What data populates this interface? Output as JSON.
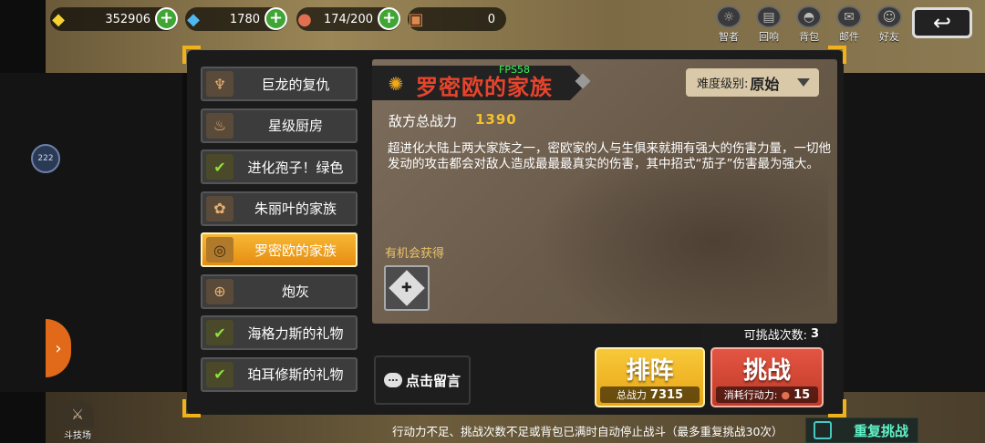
{
  "resources": {
    "gold": "352906",
    "gems": "1780",
    "stamina": "174/200",
    "tickets": "0"
  },
  "top_icons": [
    "智者",
    "回响",
    "背包",
    "邮件",
    "好友"
  ],
  "left_dial": "222",
  "stages": [
    {
      "label": "巨龙的复仇",
      "icon": "dragon-icon",
      "cleared": false
    },
    {
      "label": "星级厨房",
      "icon": "pot-icon",
      "cleared": false
    },
    {
      "label": "进化孢子！绿色",
      "icon": "check-icon",
      "cleared": true
    },
    {
      "label": "朱丽叶的家族",
      "icon": "flower-icon",
      "cleared": false
    },
    {
      "label": "罗密欧的家族",
      "icon": "spiral-icon",
      "cleared": false,
      "active": true
    },
    {
      "label": "炮灰",
      "icon": "target-icon",
      "cleared": false
    },
    {
      "label": "海格力斯的礼物",
      "icon": "check-icon",
      "cleared": true
    },
    {
      "label": "珀耳修斯的礼物",
      "icon": "check-icon",
      "cleared": true
    }
  ],
  "detail": {
    "title": "罗密欧的家族",
    "fps": "FPS58",
    "difficulty_label": "难度级别:",
    "difficulty_value": "原始",
    "enemy_power_label": "敌方总战力",
    "enemy_power_value": "1390",
    "description": "超进化大陆上两大家族之一，密欧家的人与生俱来就拥有强大的伤害力量，一切他发动的攻击都会对敌人造成最最最真实的伤害，其中招式“茄子”伤害最为强大。",
    "drop_label": "有机会获得",
    "challenges_label": "可挑战次数:",
    "challenges_value": "3"
  },
  "actions": {
    "comment": "点击留言",
    "lineup": "排阵",
    "lineup_sub_label": "总战力",
    "lineup_sub_value": "7315",
    "challenge": "挑战",
    "challenge_sub_label": "消耗行动力:",
    "challenge_sub_value": "15"
  },
  "bottom_note": "行动力不足、挑战次数不足或背包已满时自动停止战斗（最多重复挑战30次）",
  "repeat_label": "重复挑战",
  "arena_label": "斗技场",
  "colors": {
    "accent": "#f0b21c",
    "title_red": "#e8442c",
    "lineup_yellow": "#f2bb2c",
    "challenge_red": "#d3473a",
    "repeat_teal": "#5ff0c6"
  }
}
